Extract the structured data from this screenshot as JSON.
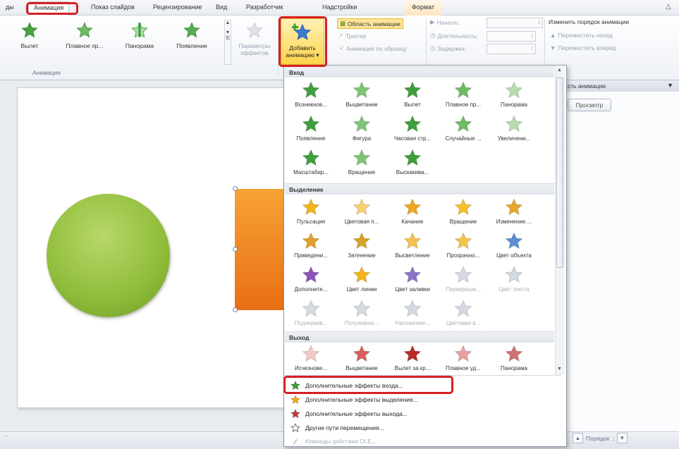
{
  "tabs": [
    {
      "label": "ды"
    },
    {
      "label": "Анимация"
    },
    {
      "label": "Показ слайдов"
    },
    {
      "label": "Рецензирование"
    },
    {
      "label": "Вид"
    },
    {
      "label": "Разработчик"
    },
    {
      "label": "Надстройки"
    },
    {
      "label": "Формат"
    }
  ],
  "gallery": [
    "Вылет",
    "Плавное пр...",
    "Панорама",
    "Появление"
  ],
  "ribbon": {
    "effect_params": "Параметры эффектов",
    "add_animation": "Добавить анимацию",
    "anim_pane": "Область анимации",
    "trigger": "Триггер",
    "painter": "Анимация по образцу",
    "start": "Начало:",
    "duration": "Длительность:",
    "delay": "Задержка:",
    "reorder": "Изменить порядок анимации",
    "move_back": "Переместить назад",
    "move_fwd": "Переместить вперед",
    "group_anim": "Анимация"
  },
  "pane": {
    "head": "сть анимации",
    "preview": "Просмотр",
    "order": "Порядок"
  },
  "dropdown": {
    "cat_entrance": "Вход",
    "cat_emphasis": "Выделение",
    "cat_exit": "Выход",
    "entrance": [
      "Возникнов...",
      "Выцветание",
      "Вылет",
      "Плавное пр...",
      "Панорама",
      "Появление",
      "Фигура",
      "Часовая стр...",
      "Случайные ...",
      "Увеличени...",
      "Масштабир...",
      "Вращение",
      "Выскакива..."
    ],
    "emphasis": [
      "Пульсация",
      "Цветовая п...",
      "Качание",
      "Вращение",
      "Изменение ...",
      "Приведени...",
      "Затенение",
      "Высветление",
      "Прозрачно...",
      "Цвет объекта",
      "Дополните...",
      "Цвет линии",
      "Цвет заливки",
      "Перекраши...",
      "Цвет текста",
      "Подчеркив...",
      "Полужирно...",
      "Наложение...",
      "Цветовая в..."
    ],
    "exit": [
      "Исчезнове...",
      "Выцветание",
      "Вылет за кр...",
      "Плавное уд...",
      "Панорама"
    ],
    "menu": [
      "Дополнительные эффекты входа...",
      "Дополнительные эффекты выделения...",
      "Дополнительные эффекты выхода...",
      "Другие пути перемещения...",
      "Команды действия OLE..."
    ]
  },
  "colors": {
    "highlight": "#d61f26",
    "entrance_green": "#3f9f3c",
    "emphasis_gold": "#f2b31c",
    "exit_red": "#c73a3a",
    "accent_ribbon": "#ffd44a"
  }
}
